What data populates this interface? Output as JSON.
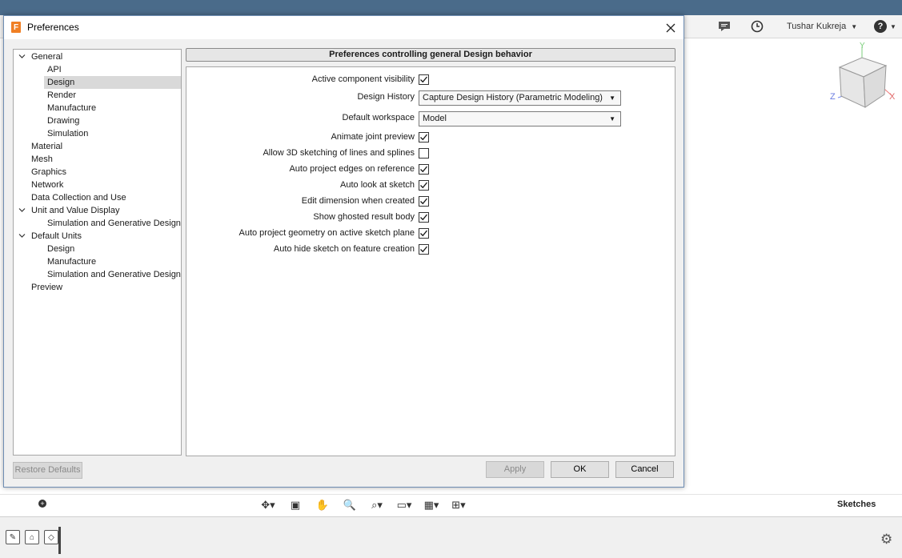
{
  "app": {
    "user_name": "Tushar Kukreja",
    "help_icon": "help-icon",
    "sketches_label": "Sketches"
  },
  "dialog": {
    "title": "Preferences",
    "close_icon": "close-icon",
    "tree": [
      {
        "label": "General",
        "level": 0,
        "expanded": true
      },
      {
        "label": "API",
        "level": 1
      },
      {
        "label": "Design",
        "level": 1,
        "selected": true
      },
      {
        "label": "Render",
        "level": 1
      },
      {
        "label": "Manufacture",
        "level": 1
      },
      {
        "label": "Drawing",
        "level": 1
      },
      {
        "label": "Simulation",
        "level": 1
      },
      {
        "label": "Material",
        "level": 0
      },
      {
        "label": "Mesh",
        "level": 0
      },
      {
        "label": "Graphics",
        "level": 0
      },
      {
        "label": "Network",
        "level": 0
      },
      {
        "label": "Data Collection and Use",
        "level": 0
      },
      {
        "label": "Unit and Value Display",
        "level": 0,
        "expanded": true
      },
      {
        "label": "Simulation and Generative Design",
        "level": 1
      },
      {
        "label": "Default Units",
        "level": 0,
        "expanded": true
      },
      {
        "label": "Design",
        "level": 1
      },
      {
        "label": "Manufacture",
        "level": 1
      },
      {
        "label": "Simulation and Generative Design",
        "level": 1
      },
      {
        "label": "Preview",
        "level": 0
      }
    ],
    "panel_header": "Preferences controlling general Design behavior",
    "rows": [
      {
        "label": "Active component visibility",
        "type": "checkbox",
        "checked": true
      },
      {
        "label": "Design History",
        "type": "select",
        "value": "Capture Design History (Parametric Modeling)"
      },
      {
        "label": "Default workspace",
        "type": "select",
        "value": "Model"
      },
      {
        "label": "Animate joint preview",
        "type": "checkbox",
        "checked": true
      },
      {
        "label": "Allow 3D sketching of lines and splines",
        "type": "checkbox",
        "checked": false
      },
      {
        "label": "Auto project edges on reference",
        "type": "checkbox",
        "checked": true
      },
      {
        "label": "Auto look at sketch",
        "type": "checkbox",
        "checked": true
      },
      {
        "label": "Edit dimension when created",
        "type": "checkbox",
        "checked": true
      },
      {
        "label": "Show ghosted result body",
        "type": "checkbox",
        "checked": true
      },
      {
        "label": "Auto project geometry on active sketch plane",
        "type": "checkbox",
        "checked": true
      },
      {
        "label": "Auto hide sketch on feature creation",
        "type": "checkbox",
        "checked": true
      }
    ],
    "buttons": {
      "restore": "Restore Defaults",
      "apply": "Apply",
      "ok": "OK",
      "cancel": "Cancel"
    }
  }
}
